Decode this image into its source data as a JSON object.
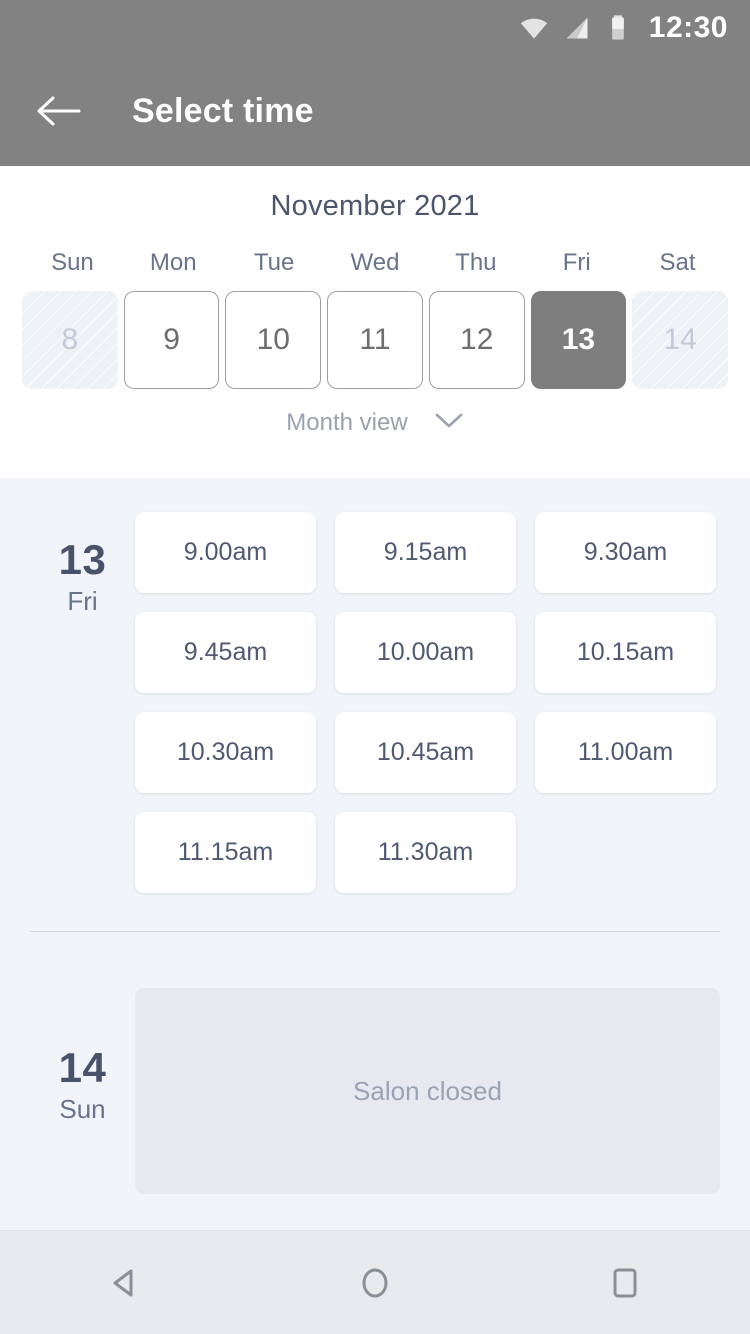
{
  "statusbar": {
    "time": "12:30",
    "icons": [
      "wifi-icon",
      "cellular-signal-icon",
      "battery-icon"
    ]
  },
  "appbar": {
    "back_icon": "arrow-left-icon",
    "title": "Select time"
  },
  "calendar": {
    "month_title": "November 2021",
    "weekdays": [
      "Sun",
      "Mon",
      "Tue",
      "Wed",
      "Thu",
      "Fri",
      "Sat"
    ],
    "days": [
      {
        "num": "8",
        "state": "disabled"
      },
      {
        "num": "9",
        "state": "normal"
      },
      {
        "num": "10",
        "state": "normal"
      },
      {
        "num": "11",
        "state": "normal"
      },
      {
        "num": "12",
        "state": "normal"
      },
      {
        "num": "13",
        "state": "selected"
      },
      {
        "num": "14",
        "state": "disabled"
      }
    ],
    "view_toggle_label": "Month view",
    "view_toggle_icon": "chevron-down-icon"
  },
  "schedule": [
    {
      "day_number": "13",
      "day_name": "Fri",
      "slots": [
        "9.00am",
        "9.15am",
        "9.30am",
        "9.45am",
        "10.00am",
        "10.15am",
        "10.30am",
        "10.45am",
        "11.00am",
        "11.15am",
        "11.30am"
      ]
    },
    {
      "day_number": "14",
      "day_name": "Sun",
      "closed_label": "Salon closed"
    }
  ],
  "navbar": {
    "back": "android-back-icon",
    "home": "android-home-icon",
    "recents": "android-recents-icon"
  },
  "colors": {
    "header_gray": "#828282",
    "selected_day": "#7e7e7e",
    "text_dark_slate": "#48536b",
    "text_slate": "#69748c",
    "panel_bg": "#f1f4f8",
    "closed_bg": "#e6eaf0",
    "card_white": "#ffffff"
  }
}
